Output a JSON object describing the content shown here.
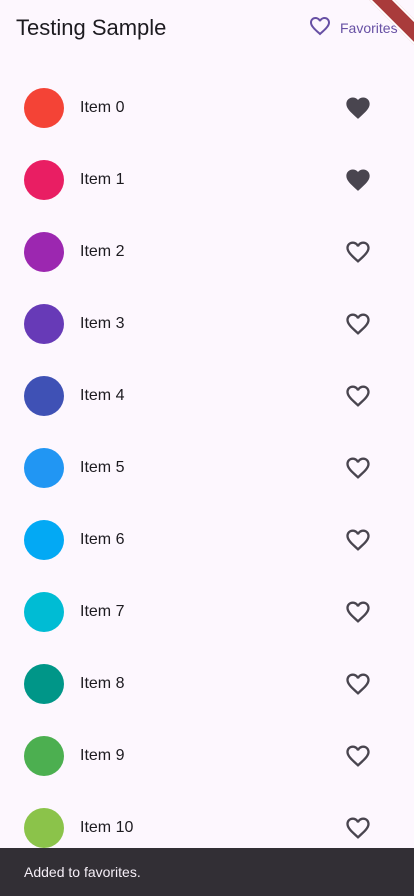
{
  "appbar": {
    "title": "Testing Sample",
    "favorites_label": "Favorites",
    "favorites_icon": "heart-outline-icon",
    "accent_color": "#6750a4"
  },
  "items": [
    {
      "label": "Item 0",
      "color": "#f44336",
      "favorite": true
    },
    {
      "label": "Item 1",
      "color": "#e91e63",
      "favorite": true
    },
    {
      "label": "Item 2",
      "color": "#9c27b0",
      "favorite": false
    },
    {
      "label": "Item 3",
      "color": "#673ab7",
      "favorite": false
    },
    {
      "label": "Item 4",
      "color": "#3f51b5",
      "favorite": false
    },
    {
      "label": "Item 5",
      "color": "#2196f3",
      "favorite": false
    },
    {
      "label": "Item 6",
      "color": "#03a9f4",
      "favorite": false
    },
    {
      "label": "Item 7",
      "color": "#00bcd4",
      "favorite": false
    },
    {
      "label": "Item 8",
      "color": "#009688",
      "favorite": false
    },
    {
      "label": "Item 9",
      "color": "#4caf50",
      "favorite": false
    },
    {
      "label": "Item 10",
      "color": "#8bc34a",
      "favorite": false
    }
  ],
  "snackbar": {
    "message": "Added to favorites."
  }
}
